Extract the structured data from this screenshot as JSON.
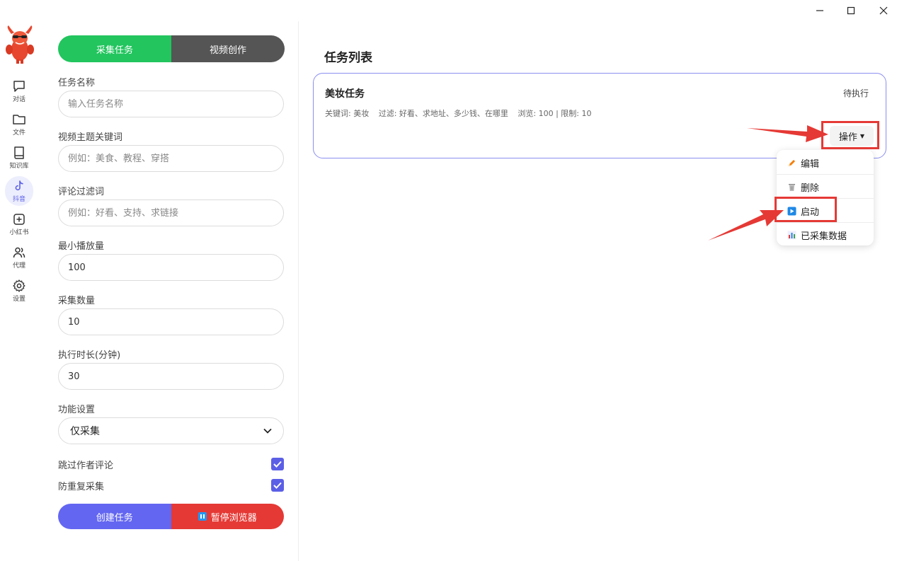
{
  "window": {
    "minimize": "—",
    "maximize": "☐",
    "close": "✕"
  },
  "sidebar": {
    "items": [
      {
        "label": "对话",
        "icon": "chat-icon"
      },
      {
        "label": "文件",
        "icon": "folder-icon"
      },
      {
        "label": "知识库",
        "icon": "book-icon"
      },
      {
        "label": "抖音",
        "icon": "tiktok-icon",
        "active": true
      },
      {
        "label": "小红书",
        "icon": "plus-square-icon"
      },
      {
        "label": "代理",
        "icon": "users-icon"
      },
      {
        "label": "设置",
        "icon": "gear-icon"
      }
    ]
  },
  "form": {
    "tabs": {
      "collect": "采集任务",
      "create": "视频创作"
    },
    "task_name": {
      "label": "任务名称",
      "placeholder": "输入任务名称",
      "value": ""
    },
    "keywords": {
      "label": "视频主题关键词",
      "placeholder": "例如：美食、教程、穿搭",
      "value": ""
    },
    "filter": {
      "label": "评论过滤词",
      "placeholder": "例如：好看、支持、求链接",
      "value": ""
    },
    "min_views": {
      "label": "最小播放量",
      "value": "100"
    },
    "count": {
      "label": "采集数量",
      "value": "10"
    },
    "duration": {
      "label": "执行时长(分钟)",
      "value": "30"
    },
    "mode": {
      "label": "功能设置",
      "value": "仅采集",
      "options": [
        "仅采集"
      ]
    },
    "skip_author": {
      "label": "跳过作者评论",
      "checked": true
    },
    "dedupe": {
      "label": "防重复采集",
      "checked": true
    },
    "create_btn": "创建任务",
    "pause_btn": "暂停浏览器"
  },
  "tasks": {
    "title": "任务列表",
    "items": [
      {
        "name": "美妆任务",
        "status": "待执行",
        "keywords": "关键词: 美妆",
        "filter": "过滤: 好看、求地址、多少钱、在哪里",
        "limits": "浏览: 100 | 限制: 10",
        "action_label": "操作"
      }
    ]
  },
  "action_menu": {
    "items": [
      {
        "label": "编辑",
        "icon": "pencil-icon"
      },
      {
        "label": "删除",
        "icon": "trash-icon"
      },
      {
        "label": "启动",
        "icon": "play-icon"
      },
      {
        "label": "已采集数据",
        "icon": "bar-chart-icon"
      }
    ]
  },
  "colors": {
    "accent": "#6366f1",
    "green": "#22c55e",
    "dark_tab": "#555555",
    "danger": "#e53935",
    "annotation": "#e53935"
  }
}
